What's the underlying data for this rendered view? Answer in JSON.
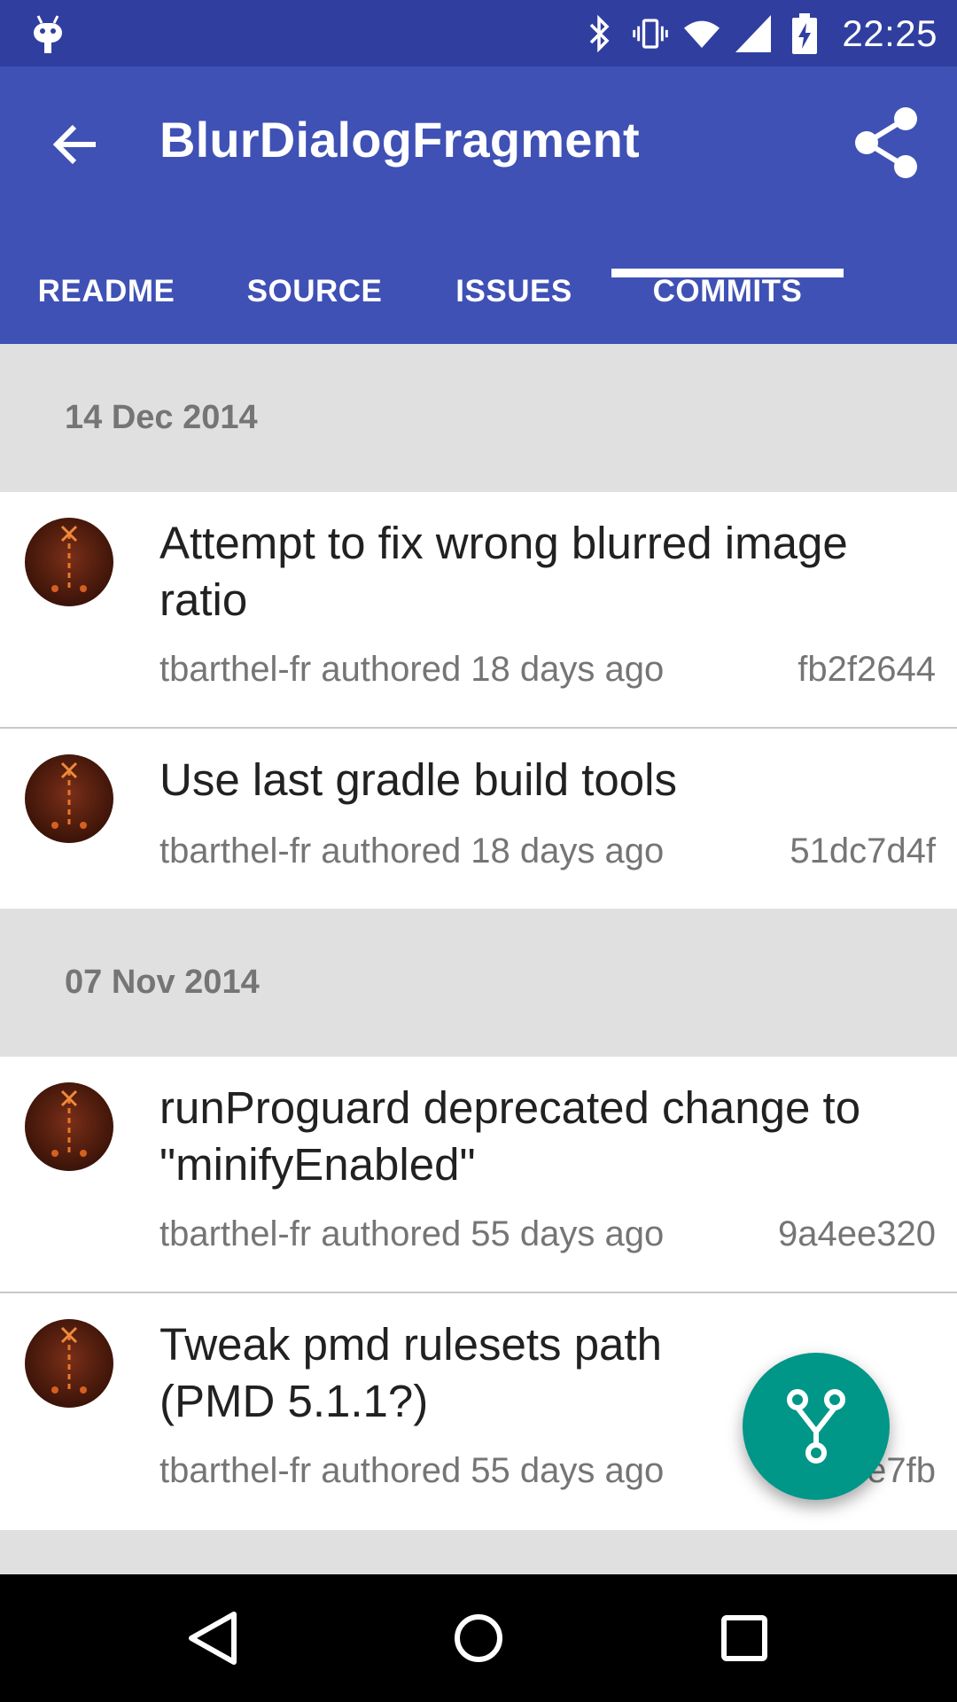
{
  "status_bar": {
    "time": "22:25",
    "icons": [
      "android-debug-icon",
      "bluetooth-icon",
      "vibrate-icon",
      "wifi-icon",
      "cell-signal-icon",
      "battery-charging-icon"
    ]
  },
  "app_bar": {
    "title": "BlurDialogFragment",
    "back_icon": "arrow-back-icon",
    "share_icon": "share-icon",
    "color": "#3f51b5",
    "status_color": "#303f9f"
  },
  "tabs": [
    {
      "label": "README",
      "selected": false
    },
    {
      "label": "SOURCE",
      "selected": false
    },
    {
      "label": "ISSUES",
      "selected": false
    },
    {
      "label": "COMMITS",
      "selected": true
    }
  ],
  "sections": [
    {
      "date": "14 Dec 2014",
      "commits": [
        {
          "message": "Attempt to fix wrong blurred image ratio",
          "author_line": "tbarthel-fr authored 18 days ago",
          "sha": "fb2f2644"
        },
        {
          "message": "Use last gradle build tools",
          "author_line": "tbarthel-fr authored 18 days ago",
          "sha": "51dc7d4f"
        }
      ]
    },
    {
      "date": "07 Nov 2014",
      "commits": [
        {
          "message": "runProguard deprecated change to \"minifyEnabled\"",
          "author_line": "tbarthel-fr authored 55 days ago",
          "sha": "9a4ee320"
        },
        {
          "message": "Tweak pmd rulesets path (PMD 5.1.1?)",
          "author_line": "tbarthel-fr authored 55 days ago",
          "sha": "e7fb"
        }
      ]
    }
  ],
  "fab": {
    "icon": "git-branch-icon",
    "color": "#009688"
  },
  "nav_bar": {
    "icons": [
      "nav-back-icon",
      "nav-home-icon",
      "nav-recents-icon"
    ]
  }
}
